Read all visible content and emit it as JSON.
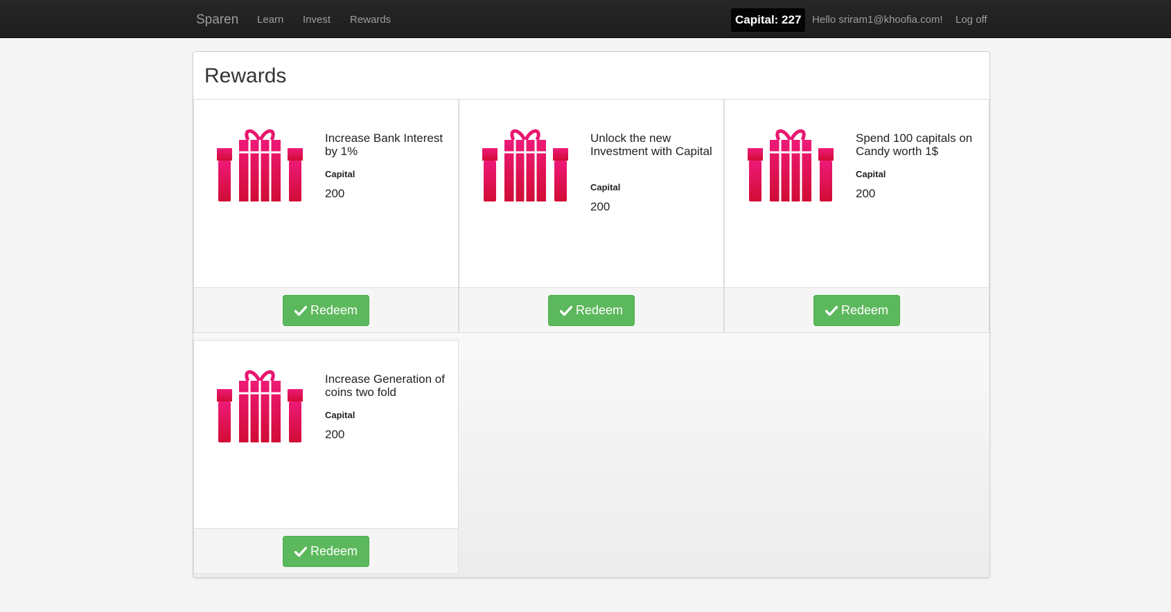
{
  "nav": {
    "brand": "Sparen",
    "links": [
      "Learn",
      "Invest",
      "Rewards"
    ],
    "capital_badge": "Capital: 227",
    "greeting": "Hello sriram1@khoofia.com!",
    "logoff": "Log off"
  },
  "page": {
    "title": "Rewards"
  },
  "rewards": [
    {
      "title": "Increase Bank Interest by 1%",
      "label": "Capital",
      "value": "200",
      "button": "Redeem",
      "icon": "gift-icon"
    },
    {
      "title": "Unlock the new Investment with Capital",
      "label": "Capital",
      "value": "200",
      "button": "Redeem",
      "icon": "gift-icon"
    },
    {
      "title": "Spend 100 capitals on Candy worth 1$",
      "label": "Capital",
      "value": "200",
      "button": "Redeem",
      "icon": "gift-icon"
    },
    {
      "title": "Increase Generation of coins two fold",
      "label": "Capital",
      "value": "200",
      "button": "Redeem",
      "icon": "gift-icon"
    }
  ],
  "colors": {
    "navbar": "#222222",
    "accent_button": "#5cb85c",
    "gift_top": "#e8166e",
    "gift_bottom": "#d10c35"
  }
}
